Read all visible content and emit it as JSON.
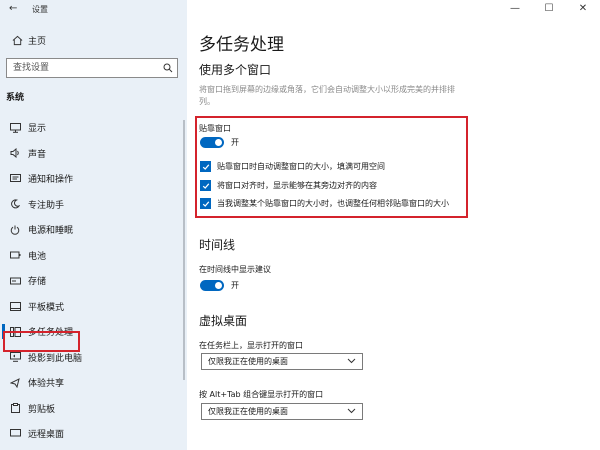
{
  "app": {
    "title": "设置"
  },
  "window_controls": {
    "minimize": "—",
    "maximize": "☐",
    "close": "✕"
  },
  "sidebar": {
    "home_label": "主页",
    "search_placeholder": "查找设置",
    "section_label": "系统",
    "items": [
      {
        "label": "显示",
        "icon": "monitor-icon"
      },
      {
        "label": "声音",
        "icon": "speaker-icon"
      },
      {
        "label": "通知和操作",
        "icon": "notification-icon"
      },
      {
        "label": "专注助手",
        "icon": "moon-icon"
      },
      {
        "label": "电源和睡眠",
        "icon": "power-icon"
      },
      {
        "label": "电池",
        "icon": "battery-icon"
      },
      {
        "label": "存储",
        "icon": "storage-icon"
      },
      {
        "label": "平板模式",
        "icon": "tablet-icon"
      },
      {
        "label": "多任务处理",
        "icon": "multitask-icon",
        "selected": true
      },
      {
        "label": "投影到此电脑",
        "icon": "project-icon"
      },
      {
        "label": "体验共享",
        "icon": "share-icon"
      },
      {
        "label": "剪贴板",
        "icon": "clipboard-icon"
      },
      {
        "label": "远程桌面",
        "icon": "remote-icon"
      }
    ]
  },
  "main": {
    "page_title": "多任务处理",
    "snap": {
      "title": "使用多个窗口",
      "description": "将窗口拖到屏幕的边缘或角落，它们会自动调整大小以形成完美的并排排列。",
      "group_label": "贴靠窗口",
      "toggle_state": "开",
      "options": [
        "贴靠窗口时自动调整窗口的大小，填满可用空间",
        "将窗口对齐时，显示能够在其旁边对齐的内容",
        "当我调整某个贴靠窗口的大小时，也调整任何相邻贴靠窗口的大小"
      ]
    },
    "timeline": {
      "title": "时间线",
      "label": "在时间线中显示建议",
      "toggle_state": "开"
    },
    "virtual_desktops": {
      "title": "虚拟桌面",
      "taskbar_label": "在任务栏上，显示打开的窗口",
      "taskbar_value": "仅限我正在使用的桌面",
      "alttab_label": "按 Alt+Tab 组合键显示打开的窗口",
      "alttab_value": "仅限我正在使用的桌面"
    }
  },
  "colors": {
    "accent": "#0067c0",
    "highlight": "#d4232c",
    "sidebar_bg": "#e9f0f7"
  }
}
